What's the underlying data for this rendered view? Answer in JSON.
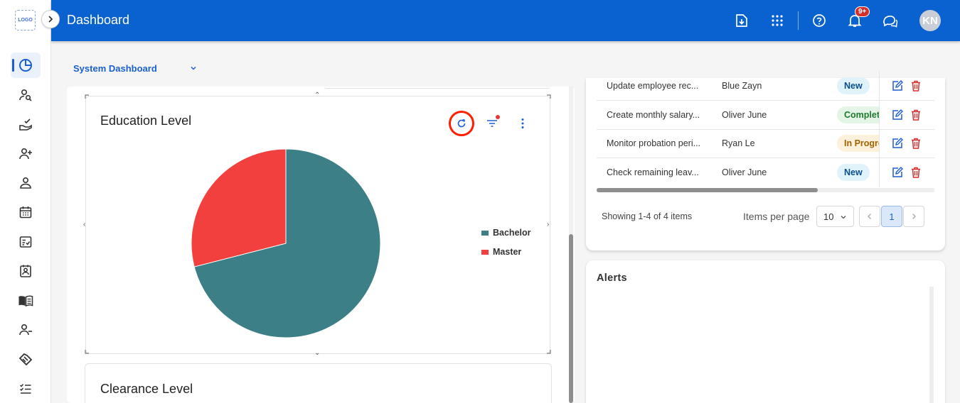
{
  "app": {
    "logo_text": "LOGO",
    "title": "Dashboard",
    "avatar_initials": "KN",
    "notification_count": "9+"
  },
  "header_icons": [
    "download-report-icon",
    "apps-grid-icon",
    "help-icon",
    "notifications-icon",
    "chat-icon"
  ],
  "sidebar": {
    "items": [
      {
        "icon": "dashboard-pie-icon",
        "active": true
      },
      {
        "icon": "user-search-icon"
      },
      {
        "icon": "hand-check-icon"
      },
      {
        "icon": "user-add-icon"
      },
      {
        "icon": "user-icon"
      },
      {
        "icon": "calendar-icon"
      },
      {
        "icon": "checklist-card-icon"
      },
      {
        "icon": "id-badge-icon"
      },
      {
        "icon": "book-icon"
      },
      {
        "icon": "user-remove-icon"
      },
      {
        "icon": "handshake-icon"
      },
      {
        "icon": "task-list-icon"
      }
    ]
  },
  "dashboard_select": {
    "value": "System Dashboard"
  },
  "education_card": {
    "title": "Education Level",
    "chart_data": {
      "type": "pie",
      "categories": [
        "Bachelor",
        "Master"
      ],
      "values": [
        71,
        29
      ],
      "colors": [
        "#3c7f86",
        "#f2403f"
      ],
      "legend": "right"
    }
  },
  "clearance_card": {
    "title": "Clearance Level"
  },
  "tasks": {
    "rows": [
      {
        "task": "Update employee rec...",
        "user": "Blue Zayn",
        "status": "New",
        "status_type": "new"
      },
      {
        "task": "Create monthly salary...",
        "user": "Oliver June",
        "status": "Complet",
        "status_type": "complete"
      },
      {
        "task": "Monitor probation peri...",
        "user": "Ryan Le",
        "status": "In Progre",
        "status_type": "progress"
      },
      {
        "task": "Check remaining leav...",
        "user": "Oliver June",
        "status": "New",
        "status_type": "new"
      }
    ],
    "showing": "Showing 1-4 of 4 items",
    "items_per_page_label": "Items per page",
    "items_per_page_value": "10",
    "current_page": "1"
  },
  "alerts": {
    "title": "Alerts"
  },
  "colors": {
    "header": "#0a62d0",
    "accent": "#1a5fd0",
    "delete": "#d32f2f"
  }
}
